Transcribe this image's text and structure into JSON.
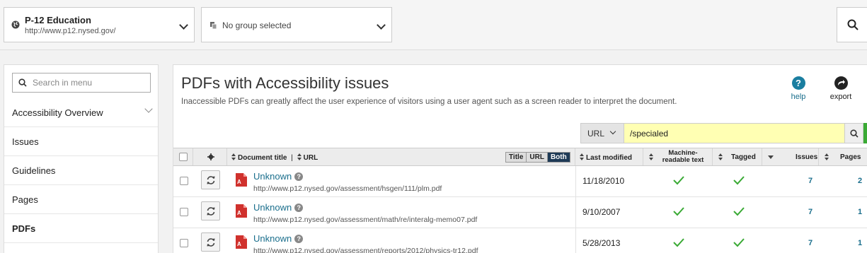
{
  "site": {
    "title": "P-12 Education",
    "url": "http://www.p12.nysed.gov/"
  },
  "group": {
    "label": "No group selected"
  },
  "sidebar": {
    "search_placeholder": "Search in menu",
    "items": [
      {
        "label": "Accessibility Overview"
      },
      {
        "label": "Issues"
      },
      {
        "label": "Guidelines"
      },
      {
        "label": "Pages"
      },
      {
        "label": "PDFs"
      }
    ]
  },
  "main": {
    "title": "PDFs with Accessibility issues",
    "description": "Inaccessible PDFs can greatly affect the user experience of visitors using a user agent such as a screen reader to interpret the document.",
    "tools": {
      "help": "help",
      "export": "export"
    },
    "filter": {
      "type": "URL",
      "value": "/specialed"
    },
    "table": {
      "headers": {
        "doc_title": "Document title",
        "sep": "|",
        "url": "URL",
        "toggle": [
          "Title",
          "URL",
          "Both"
        ],
        "last_modified": "Last modified",
        "machine_readable_1": "Machine-",
        "machine_readable_2": "readable text",
        "tagged": "Tagged",
        "issues": "Issues",
        "pages": "Pages"
      },
      "rows": [
        {
          "title": "Unknown",
          "url": "http://www.p12.nysed.gov/assessment/hsgen/111/plm.pdf",
          "modified": "11/18/2010",
          "issues": "7",
          "pages": "2"
        },
        {
          "title": "Unknown",
          "url": "http://www.p12.nysed.gov/assessment/math/re/interalg-memo07.pdf",
          "modified": "9/10/2007",
          "issues": "7",
          "pages": "1"
        },
        {
          "title": "Unknown",
          "url": "http://www.p12.nysed.gov/assessment/reports/2012/physics-tr12.pdf",
          "modified": "5/28/2013",
          "issues": "7",
          "pages": "1"
        }
      ]
    }
  },
  "colors": {
    "accent": "#1a6e8c",
    "check": "#3aaa35",
    "filter_bg": "#ffffb3",
    "pdf": "#d0312d"
  }
}
